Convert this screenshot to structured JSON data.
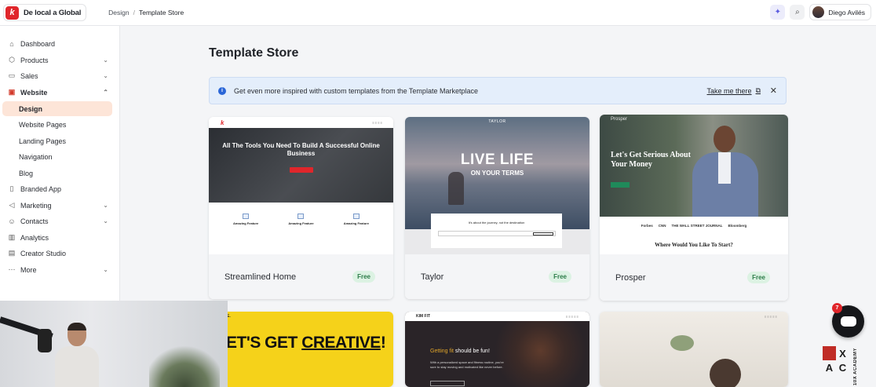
{
  "brand": {
    "name": "De local a Global",
    "logo_letter": "k"
  },
  "breadcrumb": [
    "Design",
    "Template Store"
  ],
  "breadcrumb_sep": "/",
  "user": {
    "name": "Diego Avilés"
  },
  "colors": {
    "accent": "#e0262b",
    "active_bg": "#fde5d8",
    "banner_bg": "#e4eefb",
    "free_badge": "#dcf2e3"
  },
  "sidebar": {
    "items": [
      {
        "label": "Dashboard",
        "icon": "home-icon"
      },
      {
        "label": "Products",
        "icon": "box-icon"
      },
      {
        "label": "Sales",
        "icon": "wallet-icon"
      },
      {
        "label": "Website",
        "icon": "monitor-icon"
      },
      {
        "label": "Design"
      },
      {
        "label": "Website Pages"
      },
      {
        "label": "Landing Pages"
      },
      {
        "label": "Navigation"
      },
      {
        "label": "Blog"
      },
      {
        "label": "Branded App",
        "icon": "phone-icon"
      },
      {
        "label": "Marketing",
        "icon": "megaphone-icon"
      },
      {
        "label": "Contacts",
        "icon": "users-icon"
      },
      {
        "label": "Analytics",
        "icon": "chart-icon"
      },
      {
        "label": "Creator Studio",
        "icon": "studio-icon"
      },
      {
        "label": "More",
        "icon": "dots-icon"
      }
    ]
  },
  "main": {
    "title": "Template Store",
    "banner": {
      "text": "Get even more inspired with custom templates from the Template Marketplace",
      "link": "Take me there"
    },
    "templates": [
      {
        "name": "Streamlined Home",
        "badge": "Free"
      },
      {
        "name": "Taylor",
        "badge": "Free"
      },
      {
        "name": "Prosper",
        "badge": "Free"
      }
    ]
  },
  "previews": {
    "streamlined": {
      "headline": "All The Tools You Need To Build A Successful Online Business",
      "feature_title": "Amazing Feature"
    },
    "taylor": {
      "nav": "TAYLOR",
      "headline": "LIVE LIFE",
      "subhead": "ON YOUR TERMS",
      "form_question": "It's about the journey, not the destination"
    },
    "prosper": {
      "nav": "Prosper",
      "headline": "Let's Get Serious About Your Money",
      "logos": [
        "Forbes",
        "CNN",
        "THE WALL STREET JOURNAL",
        "Bloomberg"
      ],
      "question": "Where Would You Like To Start?"
    },
    "creative": {
      "top": "ATIVE.",
      "headline_1": "LET'S GET ",
      "headline_2": "CREATIVE",
      "headline_3": "!"
    },
    "kimfit": {
      "logo": "KIM FIT",
      "headline_accent": "Getting fit",
      "headline_rest": " should be fun!",
      "sub": "With a personalized space and fitness routine, you're sure to stay moving and motivated like never before."
    }
  },
  "chat": {
    "badge_count": "7"
  },
  "watermark": {
    "side_text": "10X ACADEMY",
    "letters": [
      "",
      "X",
      "A",
      "C"
    ]
  }
}
